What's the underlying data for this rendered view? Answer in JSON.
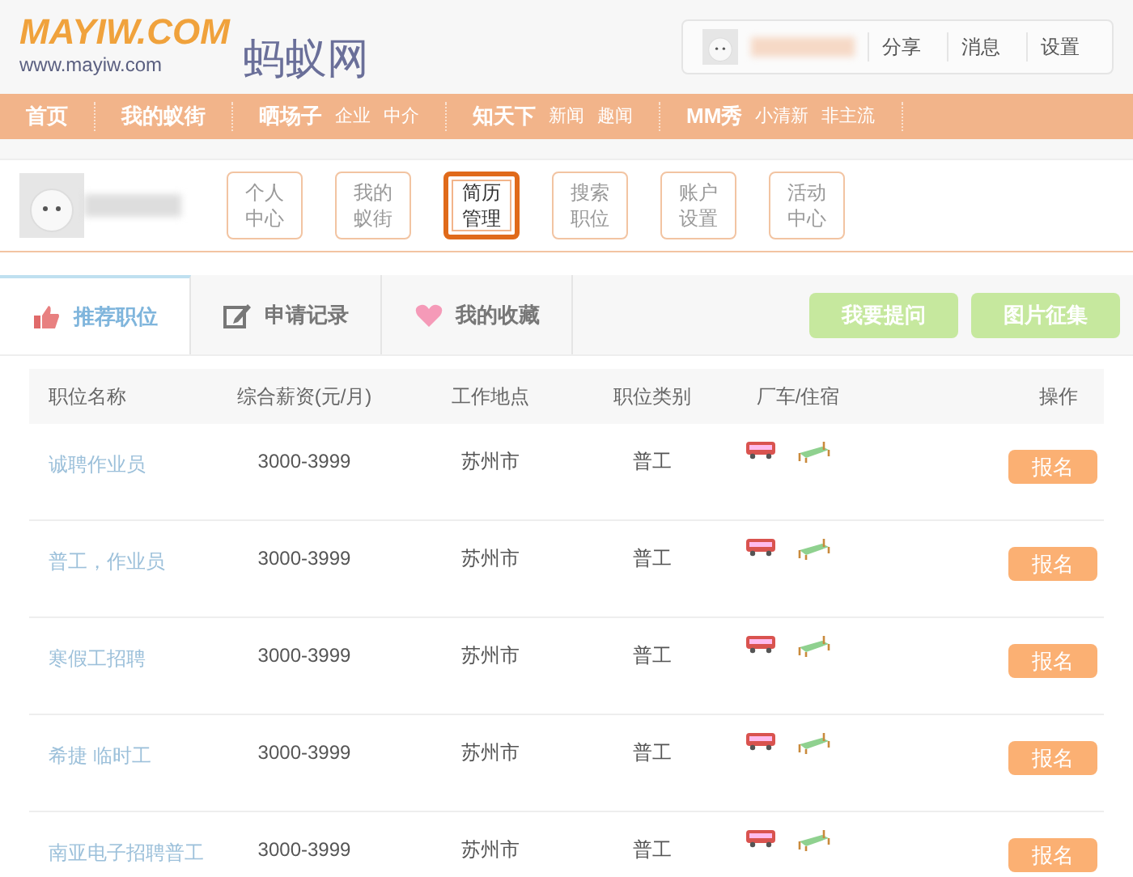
{
  "logo": {
    "wordmark": "MAYIW.COM",
    "url": "www.mayiw.com",
    "chinese": "蚂蚁网"
  },
  "top_links": [
    "分享",
    "消息",
    "设置"
  ],
  "nav": [
    {
      "label": "首页"
    },
    {
      "label": "我的蚁街"
    },
    {
      "label": "晒场子",
      "subs": [
        "企业",
        "中介"
      ]
    },
    {
      "label": "知天下",
      "subs": [
        "新闻",
        "趣闻"
      ]
    },
    {
      "label": "MM秀",
      "subs": [
        "小清新",
        "非主流"
      ]
    }
  ],
  "profile_buttons": [
    {
      "label": "个人中心",
      "selected": false
    },
    {
      "label": "我的蚁街",
      "selected": false
    },
    {
      "label": "简历管理",
      "selected": true
    },
    {
      "label": "搜索职位",
      "selected": false
    },
    {
      "label": "账户设置",
      "selected": false
    },
    {
      "label": "活动中心",
      "selected": false
    }
  ],
  "tabs": [
    {
      "label": "推荐职位",
      "selected": true
    },
    {
      "label": "申请记录",
      "selected": false
    },
    {
      "label": "我的收藏",
      "selected": false
    }
  ],
  "action_buttons": [
    "我要提问",
    "图片征集"
  ],
  "table": {
    "columns": [
      "职位名称",
      "综合薪资(元/月)",
      "工作地点",
      "职位类别",
      "厂车/住宿",
      "操作"
    ],
    "rows": [
      {
        "name": "诚聘作业员",
        "salary": "3000-3999",
        "location": "苏州市",
        "category": "普工",
        "action": "报名"
      },
      {
        "name": "普工，作业员",
        "salary": "3000-3999",
        "location": "苏州市",
        "category": "普工",
        "action": "报名"
      },
      {
        "name": "寒假工招聘",
        "salary": "3000-3999",
        "location": "苏州市",
        "category": "普工",
        "action": "报名"
      },
      {
        "name": "希捷 临时工",
        "salary": "3000-3999",
        "location": "苏州市",
        "category": "普工",
        "action": "报名"
      },
      {
        "name": "南亚电子招聘普工",
        "salary": "3000-3999",
        "location": "苏州市",
        "category": "普工",
        "action": "报名"
      }
    ]
  }
}
